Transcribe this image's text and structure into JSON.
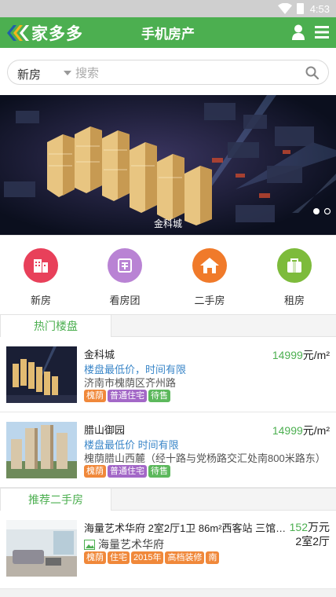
{
  "statusbar": {
    "time": "4:53"
  },
  "appbar": {
    "logo_text": "家多多",
    "title": "手机房产"
  },
  "search": {
    "category": "新房",
    "placeholder": "搜索"
  },
  "banner": {
    "caption": "金科城"
  },
  "quicknav": [
    {
      "label": "新房",
      "color": "#e8405a",
      "icon": "building-icon"
    },
    {
      "label": "看房团",
      "color": "#b983d4",
      "icon": "group-icon"
    },
    {
      "label": "二手房",
      "color": "#f07a2a",
      "icon": "house-icon"
    },
    {
      "label": "租房",
      "color": "#7dbb3b",
      "icon": "bag-icon"
    }
  ],
  "sections": {
    "hot": "热门楼盘",
    "recommend": "推荐二手房"
  },
  "hot_listings": [
    {
      "title": "金科城",
      "price_num": "14999",
      "price_unit": "元/m²",
      "promo": "楼盘最低价，时间有限",
      "address": "济南市槐荫区齐州路",
      "tags": [
        {
          "text": "槐荫",
          "color": "#f0883a"
        },
        {
          "text": "普通住宅",
          "color": "#a368c7"
        },
        {
          "text": "待售",
          "color": "#5cb85c"
        }
      ]
    },
    {
      "title": "腊山御园",
      "price_num": "14999",
      "price_unit": "元/m²",
      "promo": "楼盘最低价 时间有限",
      "address": "槐荫腊山西麓（经十路与党杨路交汇处南800米路东）",
      "tags": [
        {
          "text": "槐荫",
          "color": "#f0883a"
        },
        {
          "text": "普通住宅",
          "color": "#a368c7"
        },
        {
          "text": "待售",
          "color": "#5cb85c"
        }
      ]
    }
  ],
  "second_hand": [
    {
      "title": "海量艺术华府 2室2厅1卫 86m²西客站 三馆旁 有...",
      "price_num": "152",
      "price_unit": "万元",
      "layout": "2室2厅",
      "community": "海量艺术华府",
      "tags": [
        {
          "text": "槐荫",
          "color": "#f0883a"
        },
        {
          "text": "住宅",
          "color": "#f0883a"
        },
        {
          "text": "2015年",
          "color": "#f0883a"
        },
        {
          "text": "高档装修",
          "color": "#f0883a"
        },
        {
          "text": "南",
          "color": "#f0883a"
        }
      ]
    }
  ]
}
